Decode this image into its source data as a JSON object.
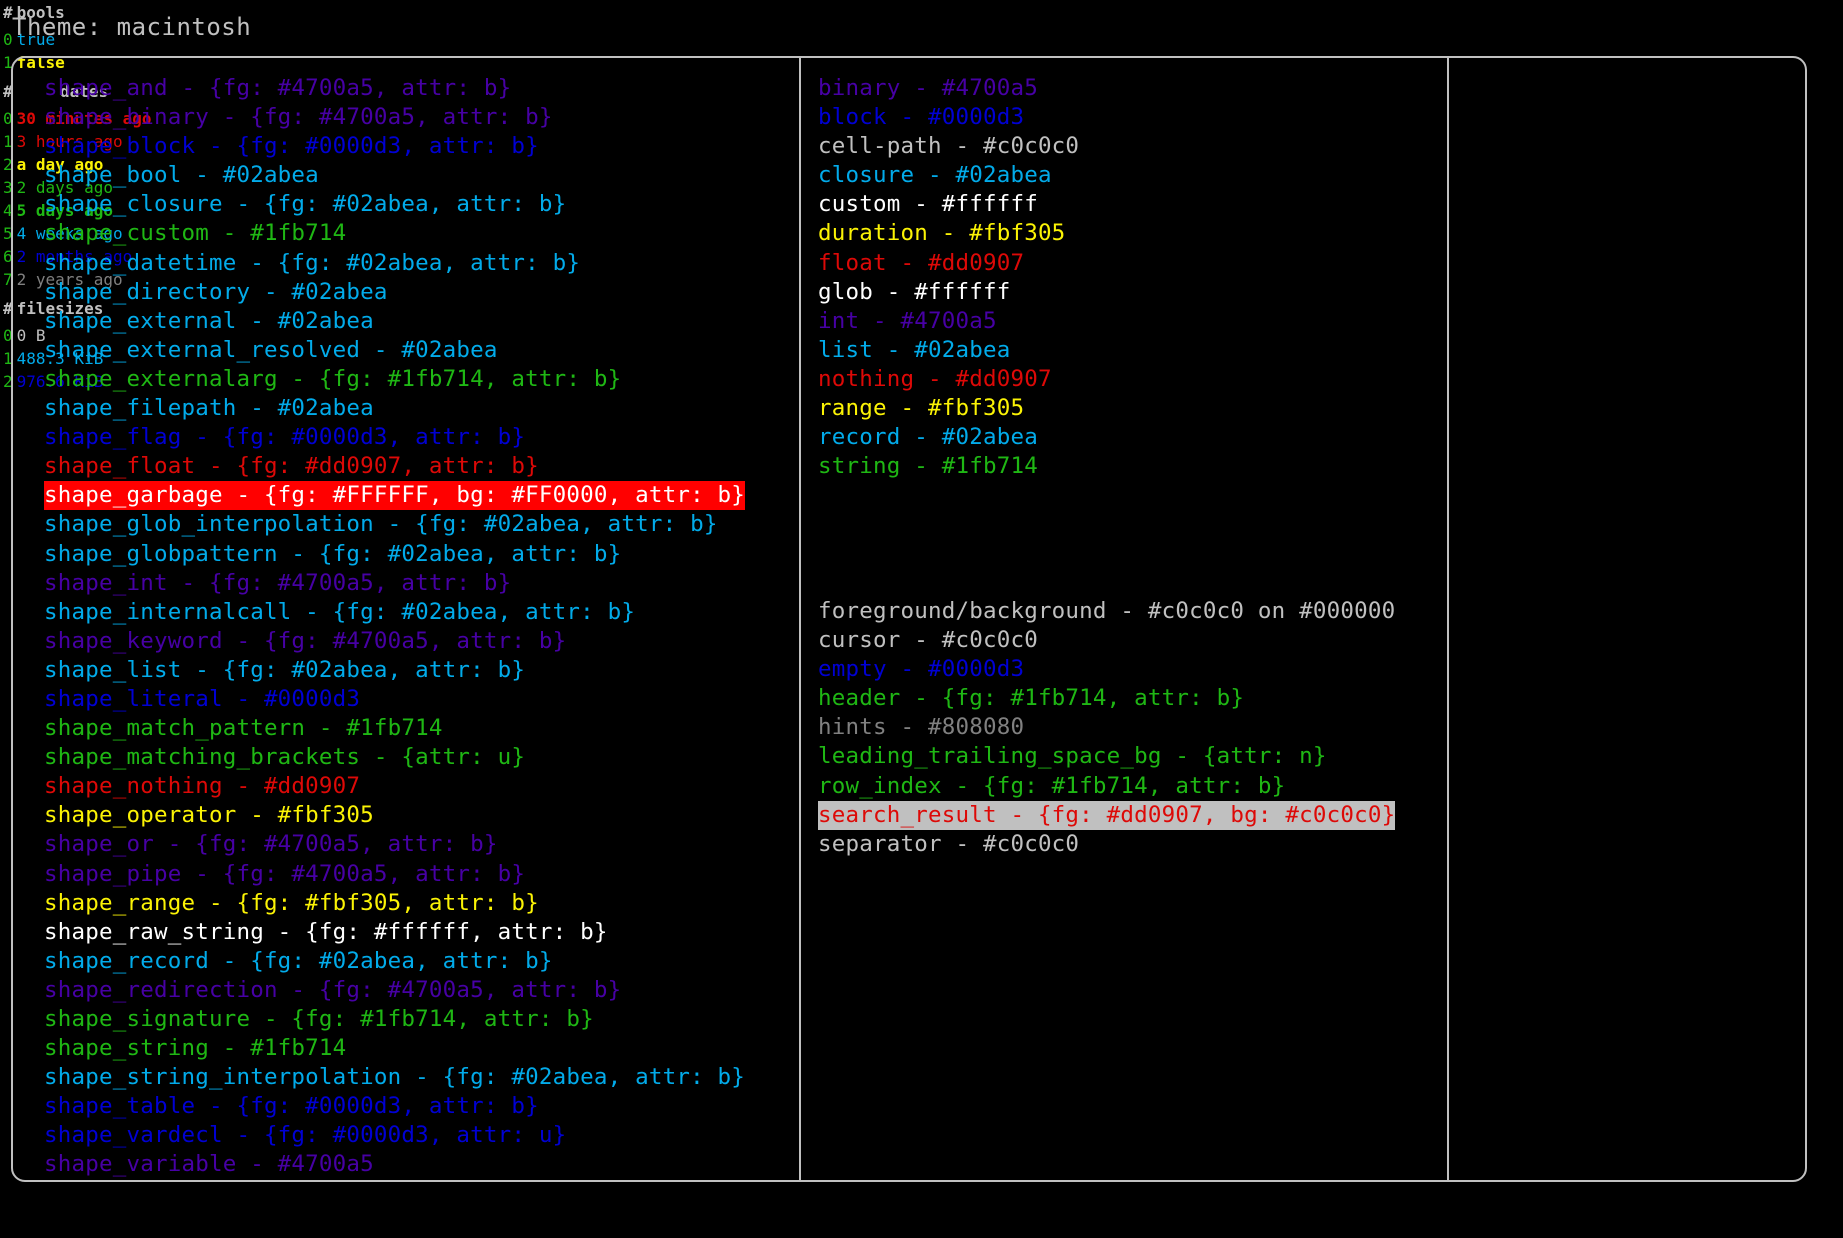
{
  "header": {
    "theme_label": "Theme: macintosh"
  },
  "shapes_column": [
    {
      "text": "shape_and - {fg: #4700a5, attr: b}",
      "fg": "#4700a5",
      "bold": true
    },
    {
      "text": "shape_binary - {fg: #4700a5, attr: b}",
      "fg": "#4700a5",
      "bold": true
    },
    {
      "text": "shape_block - {fg: #0000d3, attr: b}",
      "fg": "#0000d3",
      "bold": true
    },
    {
      "text": "shape_bool - #02abea",
      "fg": "#02abea",
      "bold": false
    },
    {
      "text": "shape_closure - {fg: #02abea, attr: b}",
      "fg": "#02abea",
      "bold": true
    },
    {
      "text": "shape_custom - #1fb714",
      "fg": "#1fb714",
      "bold": false
    },
    {
      "text": "shape_datetime - {fg: #02abea, attr: b}",
      "fg": "#02abea",
      "bold": true
    },
    {
      "text": "shape_directory - #02abea",
      "fg": "#02abea",
      "bold": false
    },
    {
      "text": "shape_external - #02abea",
      "fg": "#02abea",
      "bold": false
    },
    {
      "text": "shape_external_resolved - #02abea",
      "fg": "#02abea",
      "bold": false
    },
    {
      "text": "shape_externalarg - {fg: #1fb714, attr: b}",
      "fg": "#1fb714",
      "bold": true
    },
    {
      "text": "shape_filepath - #02abea",
      "fg": "#02abea",
      "bold": false
    },
    {
      "text": "shape_flag - {fg: #0000d3, attr: b}",
      "fg": "#0000d3",
      "bold": true
    },
    {
      "text": "shape_float - {fg: #dd0907, attr: b}",
      "fg": "#dd0907",
      "bold": true
    },
    {
      "text": "shape_garbage - {fg: #FFFFFF, bg: #FF0000, attr: b}",
      "fg": "#FFFFFF",
      "bg": "#FF0000",
      "bold": true
    },
    {
      "text": "shape_glob_interpolation - {fg: #02abea, attr: b}",
      "fg": "#02abea",
      "bold": true
    },
    {
      "text": "shape_globpattern - {fg: #02abea, attr: b}",
      "fg": "#02abea",
      "bold": true
    },
    {
      "text": "shape_int - {fg: #4700a5, attr: b}",
      "fg": "#4700a5",
      "bold": true
    },
    {
      "text": "shape_internalcall - {fg: #02abea, attr: b}",
      "fg": "#02abea",
      "bold": true
    },
    {
      "text": "shape_keyword - {fg: #4700a5, attr: b}",
      "fg": "#4700a5",
      "bold": true
    },
    {
      "text": "shape_list - {fg: #02abea, attr: b}",
      "fg": "#02abea",
      "bold": true
    },
    {
      "text": "shape_literal - #0000d3",
      "fg": "#0000d3",
      "bold": false
    },
    {
      "text": "shape_match_pattern - #1fb714",
      "fg": "#1fb714",
      "bold": false
    },
    {
      "text": "shape_matching_brackets - {attr: u}",
      "fg": "#1fb714",
      "bold": false,
      "underline": true
    },
    {
      "text": "shape_nothing - #dd0907",
      "fg": "#dd0907",
      "bold": false
    },
    {
      "text": "shape_operator - #fbf305",
      "fg": "#fbf305",
      "bold": false
    },
    {
      "text": "shape_or - {fg: #4700a5, attr: b}",
      "fg": "#4700a5",
      "bold": true
    },
    {
      "text": "shape_pipe - {fg: #4700a5, attr: b}",
      "fg": "#4700a5",
      "bold": true
    },
    {
      "text": "shape_range - {fg: #fbf305, attr: b}",
      "fg": "#fbf305",
      "bold": true
    },
    {
      "text": "shape_raw_string - {fg: #ffffff, attr: b}",
      "fg": "#ffffff",
      "bold": true
    },
    {
      "text": "shape_record - {fg: #02abea, attr: b}",
      "fg": "#02abea",
      "bold": true
    },
    {
      "text": "shape_redirection - {fg: #4700a5, attr: b}",
      "fg": "#4700a5",
      "bold": true
    },
    {
      "text": "shape_signature - {fg: #1fb714, attr: b}",
      "fg": "#1fb714",
      "bold": true
    },
    {
      "text": "shape_string - #1fb714",
      "fg": "#1fb714",
      "bold": false
    },
    {
      "text": "shape_string_interpolation - {fg: #02abea, attr: b}",
      "fg": "#02abea",
      "bold": true
    },
    {
      "text": "shape_table - {fg: #0000d3, attr: b}",
      "fg": "#0000d3",
      "bold": true
    },
    {
      "text": "shape_vardecl - {fg: #0000d3, attr: u}",
      "fg": "#0000d3",
      "bold": false,
      "underline": true
    },
    {
      "text": "shape_variable - #4700a5",
      "fg": "#4700a5",
      "bold": false
    }
  ],
  "types_column": [
    {
      "text": "binary - #4700a5",
      "fg": "#4700a5",
      "bold": false
    },
    {
      "text": "block - #0000d3",
      "fg": "#0000d3",
      "bold": false
    },
    {
      "text": "cell-path - #c0c0c0",
      "fg": "#c0c0c0",
      "bold": false
    },
    {
      "text": "closure - #02abea",
      "fg": "#02abea",
      "bold": false
    },
    {
      "text": "custom - #ffffff",
      "fg": "#ffffff",
      "bold": false
    },
    {
      "text": "duration - #fbf305",
      "fg": "#fbf305",
      "bold": false
    },
    {
      "text": "float - #dd0907",
      "fg": "#dd0907",
      "bold": false
    },
    {
      "text": "glob - #ffffff",
      "fg": "#ffffff",
      "bold": false
    },
    {
      "text": "int - #4700a5",
      "fg": "#4700a5",
      "bold": false
    },
    {
      "text": "list - #02abea",
      "fg": "#02abea",
      "bold": false
    },
    {
      "text": "nothing - #dd0907",
      "fg": "#dd0907",
      "bold": false
    },
    {
      "text": "range - #fbf305",
      "fg": "#fbf305",
      "bold": false
    },
    {
      "text": "record - #02abea",
      "fg": "#02abea",
      "bold": false
    },
    {
      "text": "string - #1fb714",
      "fg": "#1fb714",
      "bold": false
    }
  ],
  "ui_column": [
    {
      "text": "foreground/background - #c0c0c0 on #000000",
      "fg": "#c0c0c0",
      "bold": false
    },
    {
      "text": "cursor - #c0c0c0",
      "fg": "#c0c0c0",
      "bold": false
    },
    {
      "text": "empty - #0000d3",
      "fg": "#0000d3",
      "bold": false
    },
    {
      "text": "header - {fg: #1fb714, attr: b}",
      "fg": "#1fb714",
      "bold": true
    },
    {
      "text": "hints - #808080",
      "fg": "#808080",
      "bold": false
    },
    {
      "text": "leading_trailing_space_bg - {attr: n}",
      "fg": "#1fb714",
      "bold": false
    },
    {
      "text": "row_index - {fg: #1fb714, attr: b}",
      "fg": "#1fb714",
      "bold": true
    },
    {
      "text": "search_result - {fg: #dd0907, bg: #c0c0c0}",
      "fg": "#dd0907",
      "bg": "#c0c0c0",
      "bold": false
    },
    {
      "text": "separator - #c0c0c0",
      "fg": "#c0c0c0",
      "bold": false
    }
  ],
  "tables": {
    "bools": {
      "index_header": "#",
      "value_header": "bools",
      "header_color": "#1fb714",
      "rows": [
        {
          "index": "0",
          "value": "true",
          "fg": "#02abea",
          "bold": false
        },
        {
          "index": "1",
          "value": "false",
          "fg": "#fbf305",
          "bold": true
        }
      ]
    },
    "dates": {
      "index_header": "#",
      "value_header": "dates",
      "header_color": "#1fb714",
      "rows": [
        {
          "index": "0",
          "value": "30 minutes ago",
          "fg": "#dd0907",
          "bold": true
        },
        {
          "index": "1",
          "value": "3 hours ago",
          "fg": "#dd0907",
          "bold": false
        },
        {
          "index": "2",
          "value": "a day ago",
          "fg": "#fbf305",
          "bold": true
        },
        {
          "index": "3",
          "value": "2 days ago",
          "fg": "#1fb714",
          "bold": false
        },
        {
          "index": "4",
          "value": "5 days ago",
          "fg": "#1fb714",
          "bold": true
        },
        {
          "index": "5",
          "value": "4 weeks ago",
          "fg": "#02abea",
          "bold": false
        },
        {
          "index": "6",
          "value": "2 months ago",
          "fg": "#0000d3",
          "bold": false
        },
        {
          "index": "7",
          "value": "2 years ago",
          "fg": "#808080",
          "bold": false
        }
      ]
    },
    "filesizes": {
      "index_header": "#",
      "value_header": "filesizes",
      "header_color": "#1fb714",
      "rows": [
        {
          "index": "0",
          "value": "0 B",
          "fg": "#c0c0c0",
          "bold": false
        },
        {
          "index": "1",
          "value": "488.3 KiB",
          "fg": "#02abea",
          "bold": false
        },
        {
          "index": "2",
          "value": "976.6 KiB",
          "fg": "#0000d3",
          "bold": false
        }
      ]
    }
  },
  "palette": {
    "background": "#000000",
    "foreground": "#c0c0c0",
    "border": "#c0c0c0",
    "purple": "#4700a5",
    "blue": "#0000d3",
    "cyan": "#02abea",
    "green": "#1fb714",
    "red": "#dd0907",
    "yellow": "#fbf305",
    "white": "#ffffff",
    "gray": "#808080",
    "highlight_red_bg": "#FF0000",
    "highlight_gray_bg": "#c0c0c0"
  }
}
